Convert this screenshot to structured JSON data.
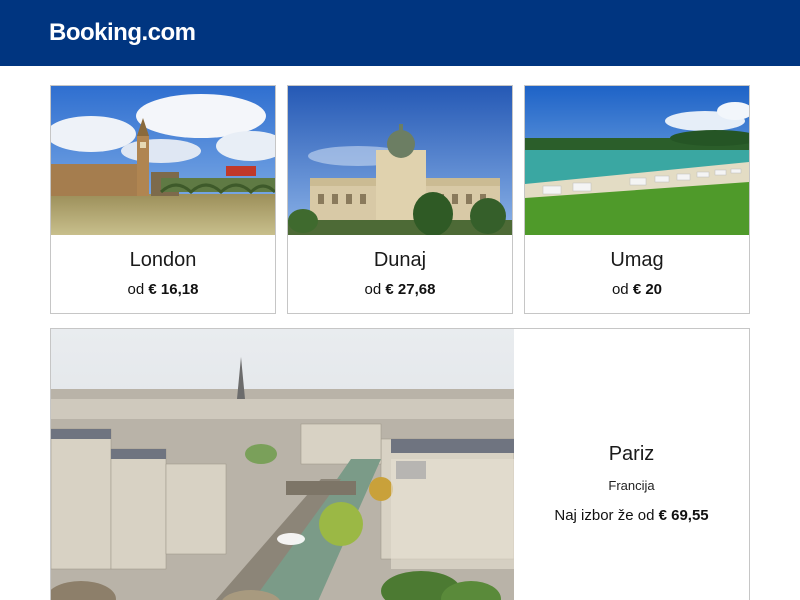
{
  "header": {
    "logo": "Booking.com"
  },
  "destinations": [
    {
      "city": "London",
      "price_prefix": "od",
      "price": "€ 16,18"
    },
    {
      "city": "Dunaj",
      "price_prefix": "od",
      "price": "€ 27,68"
    },
    {
      "city": "Umag",
      "price_prefix": "od",
      "price": "€ 20"
    }
  ],
  "featured": {
    "city": "Pariz",
    "country": "Francija",
    "price_prefix": "Naj izbor že od",
    "price": "€ 69,55"
  },
  "colors": {
    "header_bg": "#003580",
    "card_border": "#c6c6c6"
  }
}
